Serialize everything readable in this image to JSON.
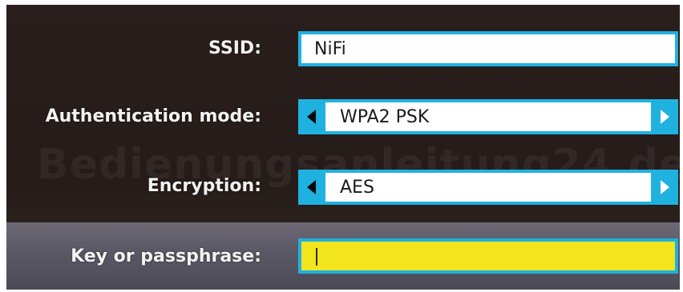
{
  "watermark": "Bedienungsanleitung24.de",
  "form": {
    "ssid": {
      "label": "SSID:",
      "value": "NiFi"
    },
    "auth_mode": {
      "label": "Authentication mode:",
      "value": "WPA2 PSK"
    },
    "encryption": {
      "label": "Encryption:",
      "value": "AES"
    },
    "key": {
      "label": "Key or passphrase:",
      "value": ""
    }
  },
  "colors": {
    "field_border": "#1fb1e0",
    "active_field": "#f2e51e",
    "background": "#271d1a"
  }
}
